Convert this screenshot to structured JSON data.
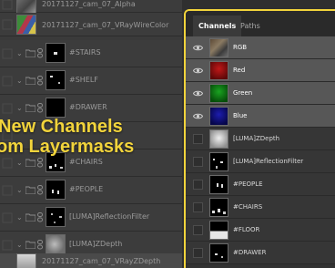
{
  "layers": [
    {
      "name": "20171127_cam_07_Alpha",
      "kind": "photo",
      "top": true
    },
    {
      "name": "20171127_cam_07_VRayWireColor",
      "kind": "photo",
      "top": true
    },
    {
      "name": "#STAIRS",
      "kind": "mask"
    },
    {
      "name": "#SHELF",
      "kind": "mask"
    },
    {
      "name": "#DRAWER",
      "kind": "mask"
    },
    {
      "name": "#CHAIRS",
      "kind": "mask"
    },
    {
      "name": "#PEOPLE",
      "kind": "mask"
    },
    {
      "name": "[LUMA]ReflectionFilter",
      "kind": "mask"
    },
    {
      "name": "[LUMA]ZDepth",
      "kind": "mask"
    },
    {
      "name": "20171127_cam_07_VRayZDepth",
      "kind": "photo"
    }
  ],
  "headline": {
    "line1": "New Channels",
    "line2": "om Layermasks"
  },
  "channels_panel": {
    "tabs": [
      {
        "label": "Channels",
        "active": true
      },
      {
        "label": "Paths",
        "active": false
      }
    ],
    "channels": [
      {
        "name": "RGB",
        "visible": true,
        "color": "rgb"
      },
      {
        "name": "Red",
        "visible": true,
        "color": "#8a1010"
      },
      {
        "name": "Green",
        "visible": true,
        "color": "#0f7a16"
      },
      {
        "name": "Blue",
        "visible": true,
        "color": "#101080"
      },
      {
        "name": "[LUMA]ZDepth",
        "visible": false,
        "color": "luma"
      },
      {
        "name": "[LUMA]ReflectionFilter",
        "visible": false,
        "color": "mask"
      },
      {
        "name": "#PEOPLE",
        "visible": false,
        "color": "mask"
      },
      {
        "name": "#CHAIRS",
        "visible": false,
        "color": "mask"
      },
      {
        "name": "#FLOOR",
        "visible": false,
        "color": "mask"
      },
      {
        "name": "#DRAWER",
        "visible": false,
        "color": "mask"
      }
    ]
  },
  "colors": {
    "accent_yellow": "#f2d43b",
    "panel_bg": "#323232",
    "selected_row": "#575757"
  }
}
